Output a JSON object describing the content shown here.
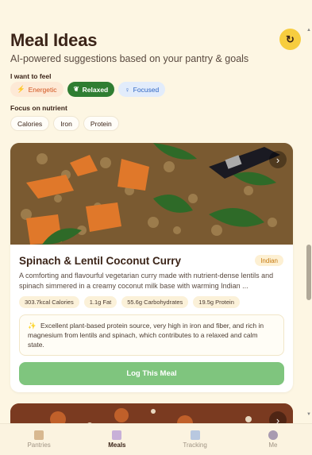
{
  "header": {
    "title": "Meal Ideas",
    "subtitle": "AI-powered suggestions based on your pantry & goals",
    "refresh_icon": "refresh-icon"
  },
  "mood": {
    "label": "I want to feel",
    "options": [
      {
        "label": "Energetic",
        "icon": "bolt-icon",
        "selected": false
      },
      {
        "label": "Relaxed",
        "icon": "leaf-icon",
        "selected": true
      },
      {
        "label": "Focused",
        "icon": "bulb-icon",
        "selected": false
      }
    ]
  },
  "nutrient": {
    "label": "Focus on nutrient",
    "options": [
      "Calories",
      "Iron",
      "Protein"
    ]
  },
  "meal": {
    "name": "Spinach & Lentil Coconut Curry",
    "cuisine": "Indian",
    "description": "A comforting and flavourful vegetarian curry made with nutrient-dense lentils and spinach simmered in a creamy coconut milk base with warming Indian ...",
    "nutrition": [
      "303.7kcal Calories",
      "1.1g Fat",
      "55.6g Carbohydrates",
      "19.5g Protein"
    ],
    "insight": "Excellent plant-based protein source, very high in iron and fiber, and rich in magnesium from lentils and spinach, which contributes to a relaxed and calm state.",
    "log_button": "Log This Meal"
  },
  "nav": [
    {
      "label": "Pantries",
      "icon": "box-icon",
      "active": false
    },
    {
      "label": "Meals",
      "icon": "meals-icon",
      "active": true
    },
    {
      "label": "Tracking",
      "icon": "chart-icon",
      "active": false
    },
    {
      "label": "Me",
      "icon": "person-icon",
      "active": false
    }
  ],
  "colors": {
    "background": "#fdf6e3",
    "accent_green": "#2f7d32",
    "log_button": "#7fc57e",
    "refresh": "#f7cd3f"
  }
}
